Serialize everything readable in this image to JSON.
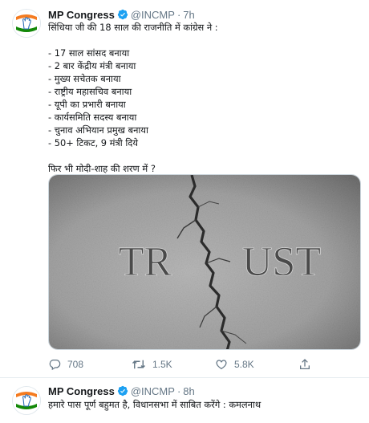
{
  "tweets": [
    {
      "author": "MP Congress",
      "handle": "@INCMP",
      "separator": "·",
      "time": "7h",
      "lines": [
        "सिंधिया जी की 18 साल की राजनीति में कांग्रेस ने :",
        "",
        "- 17 साल सांसद बनाया",
        "- 2 बार केंद्रीय मंत्री बनाया",
        "- मुख्य सचेतक बनाया",
        "- राष्ट्रीय महासचिव बनाया",
        "- यूपी का प्रभारी बनाया",
        "- कार्यसमिति सदस्य बनाया",
        "- चुनाव अभियान प्रमुख बनाया",
        "- 50+ टिकट, 9 मंत्री दिये",
        "",
        "फिर भी मोदी-शाह की शरण में ?"
      ],
      "image_text": {
        "left": "TR",
        "right": "UST"
      },
      "actions": {
        "replies": "708",
        "retweets": "1.5K",
        "likes": "5.8K"
      }
    },
    {
      "author": "MP Congress",
      "handle": "@INCMP",
      "separator": "·",
      "time": "8h",
      "lines": [
        "हमारे पास पूर्ण बहुमत है, विधानसभा में साबित करेंगे : कमलनाथ"
      ]
    }
  ],
  "colors": {
    "verified": "#1da1f2",
    "text": "#14171a",
    "secondary": "#657786",
    "congress_saffron": "#f47b20",
    "congress_green": "#138808"
  },
  "icons": [
    "verified-badge-icon",
    "reply-icon",
    "retweet-icon",
    "like-icon",
    "share-icon"
  ]
}
